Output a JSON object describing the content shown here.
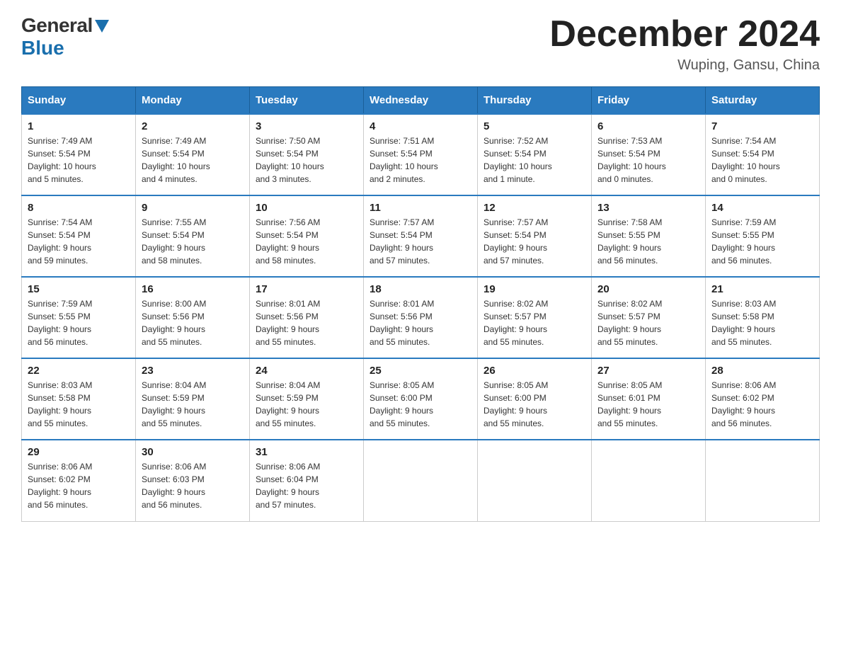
{
  "logo": {
    "general": "General",
    "blue": "Blue",
    "subtitle": "Blue"
  },
  "header": {
    "month": "December 2024",
    "location": "Wuping, Gansu, China"
  },
  "weekdays": [
    "Sunday",
    "Monday",
    "Tuesday",
    "Wednesday",
    "Thursday",
    "Friday",
    "Saturday"
  ],
  "weeks": [
    [
      {
        "day": "1",
        "sunrise": "7:49 AM",
        "sunset": "5:54 PM",
        "daylight": "10 hours and 5 minutes."
      },
      {
        "day": "2",
        "sunrise": "7:49 AM",
        "sunset": "5:54 PM",
        "daylight": "10 hours and 4 minutes."
      },
      {
        "day": "3",
        "sunrise": "7:50 AM",
        "sunset": "5:54 PM",
        "daylight": "10 hours and 3 minutes."
      },
      {
        "day": "4",
        "sunrise": "7:51 AM",
        "sunset": "5:54 PM",
        "daylight": "10 hours and 2 minutes."
      },
      {
        "day": "5",
        "sunrise": "7:52 AM",
        "sunset": "5:54 PM",
        "daylight": "10 hours and 1 minute."
      },
      {
        "day": "6",
        "sunrise": "7:53 AM",
        "sunset": "5:54 PM",
        "daylight": "10 hours and 0 minutes."
      },
      {
        "day": "7",
        "sunrise": "7:54 AM",
        "sunset": "5:54 PM",
        "daylight": "10 hours and 0 minutes."
      }
    ],
    [
      {
        "day": "8",
        "sunrise": "7:54 AM",
        "sunset": "5:54 PM",
        "daylight": "9 hours and 59 minutes."
      },
      {
        "day": "9",
        "sunrise": "7:55 AM",
        "sunset": "5:54 PM",
        "daylight": "9 hours and 58 minutes."
      },
      {
        "day": "10",
        "sunrise": "7:56 AM",
        "sunset": "5:54 PM",
        "daylight": "9 hours and 58 minutes."
      },
      {
        "day": "11",
        "sunrise": "7:57 AM",
        "sunset": "5:54 PM",
        "daylight": "9 hours and 57 minutes."
      },
      {
        "day": "12",
        "sunrise": "7:57 AM",
        "sunset": "5:54 PM",
        "daylight": "9 hours and 57 minutes."
      },
      {
        "day": "13",
        "sunrise": "7:58 AM",
        "sunset": "5:55 PM",
        "daylight": "9 hours and 56 minutes."
      },
      {
        "day": "14",
        "sunrise": "7:59 AM",
        "sunset": "5:55 PM",
        "daylight": "9 hours and 56 minutes."
      }
    ],
    [
      {
        "day": "15",
        "sunrise": "7:59 AM",
        "sunset": "5:55 PM",
        "daylight": "9 hours and 56 minutes."
      },
      {
        "day": "16",
        "sunrise": "8:00 AM",
        "sunset": "5:56 PM",
        "daylight": "9 hours and 55 minutes."
      },
      {
        "day": "17",
        "sunrise": "8:01 AM",
        "sunset": "5:56 PM",
        "daylight": "9 hours and 55 minutes."
      },
      {
        "day": "18",
        "sunrise": "8:01 AM",
        "sunset": "5:56 PM",
        "daylight": "9 hours and 55 minutes."
      },
      {
        "day": "19",
        "sunrise": "8:02 AM",
        "sunset": "5:57 PM",
        "daylight": "9 hours and 55 minutes."
      },
      {
        "day": "20",
        "sunrise": "8:02 AM",
        "sunset": "5:57 PM",
        "daylight": "9 hours and 55 minutes."
      },
      {
        "day": "21",
        "sunrise": "8:03 AM",
        "sunset": "5:58 PM",
        "daylight": "9 hours and 55 minutes."
      }
    ],
    [
      {
        "day": "22",
        "sunrise": "8:03 AM",
        "sunset": "5:58 PM",
        "daylight": "9 hours and 55 minutes."
      },
      {
        "day": "23",
        "sunrise": "8:04 AM",
        "sunset": "5:59 PM",
        "daylight": "9 hours and 55 minutes."
      },
      {
        "day": "24",
        "sunrise": "8:04 AM",
        "sunset": "5:59 PM",
        "daylight": "9 hours and 55 minutes."
      },
      {
        "day": "25",
        "sunrise": "8:05 AM",
        "sunset": "6:00 PM",
        "daylight": "9 hours and 55 minutes."
      },
      {
        "day": "26",
        "sunrise": "8:05 AM",
        "sunset": "6:00 PM",
        "daylight": "9 hours and 55 minutes."
      },
      {
        "day": "27",
        "sunrise": "8:05 AM",
        "sunset": "6:01 PM",
        "daylight": "9 hours and 55 minutes."
      },
      {
        "day": "28",
        "sunrise": "8:06 AM",
        "sunset": "6:02 PM",
        "daylight": "9 hours and 56 minutes."
      }
    ],
    [
      {
        "day": "29",
        "sunrise": "8:06 AM",
        "sunset": "6:02 PM",
        "daylight": "9 hours and 56 minutes."
      },
      {
        "day": "30",
        "sunrise": "8:06 AM",
        "sunset": "6:03 PM",
        "daylight": "9 hours and 56 minutes."
      },
      {
        "day": "31",
        "sunrise": "8:06 AM",
        "sunset": "6:04 PM",
        "daylight": "9 hours and 57 minutes."
      },
      null,
      null,
      null,
      null
    ]
  ],
  "labels": {
    "sunrise": "Sunrise:",
    "sunset": "Sunset:",
    "daylight": "Daylight:"
  }
}
